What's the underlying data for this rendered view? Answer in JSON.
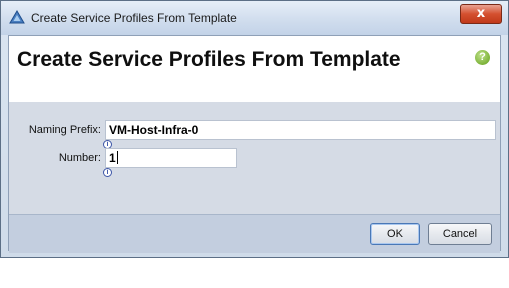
{
  "window": {
    "title": "Create Service Profiles From Template",
    "close_glyph": "x"
  },
  "header": {
    "title": "Create Service Profiles From Template",
    "help_glyph": "?"
  },
  "form": {
    "naming_prefix": {
      "label": "Naming Prefix:",
      "value": "VM-Host-Infra-0"
    },
    "number": {
      "label": "Number:",
      "value": "1"
    },
    "info_glyph": "i"
  },
  "buttons": {
    "ok_label": "OK",
    "cancel_label": "Cancel"
  },
  "colors": {
    "accent": "#4a78b6",
    "close_red": "#c0391a",
    "help_green": "#7db33a"
  }
}
